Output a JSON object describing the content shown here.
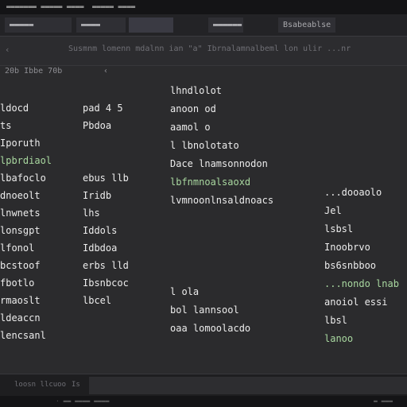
{
  "menubar": {
    "left": "▬▬▬▬▬▬▬ ▬▬▬▬▬ ▬▬▬▬",
    "right": "▬▬▬▬▬ ▬▬▬▬"
  },
  "tabs": [
    {
      "label": "▬▬▬▬▬",
      "state": "inactive"
    },
    {
      "label": "▬▬▬▬",
      "state": "inactive"
    },
    {
      "label": "",
      "state": "active"
    },
    {
      "label": "▬▬▬▬▬▬",
      "state": "inactive"
    },
    {
      "label": "Bsabeablse",
      "state": "inactive"
    }
  ],
  "toolbar": {
    "left_icon": "‹",
    "breadcrumb": "Susmnm lomenn mdalnn  ian   \"a\"  Ibrnalamnalbeml  lon  ulir  ...nr"
  },
  "gutter": {
    "left": "20b   Ibbe   70b",
    "mid": "‹"
  },
  "code_columns": {
    "col1": [
      {
        "text": "  ldocd",
        "class": "w"
      },
      {
        "text": "  ts",
        "class": "w"
      },
      {
        "text": "Iporuth",
        "class": "w"
      },
      {
        "text": "lpbrdiaol",
        "class": "g"
      },
      {
        "text": "  lbafoclo",
        "class": "w"
      },
      {
        "text": "  dnoeolt",
        "class": "w"
      },
      {
        "text": "lnwnets",
        "class": "w"
      },
      {
        "text": "lonsgpt",
        "class": "w"
      },
      {
        "text": "  lfonol",
        "class": "w"
      },
      {
        "text": "  bcstoof",
        "class": "w"
      },
      {
        "text": "  fbotlo",
        "class": "w"
      },
      {
        "text": "  rmaoslt",
        "class": "w"
      },
      {
        "text": "  ldeaccn",
        "class": "w"
      },
      {
        "text": "  lencsanl",
        "class": "w"
      }
    ],
    "col2": [
      {
        "text": "pad 4 5",
        "class": "w"
      },
      {
        "text": "Pbdoa",
        "class": "w"
      },
      {
        "text": "",
        "class": "w"
      },
      {
        "text": "",
        "class": "w"
      },
      {
        "text": "ebus llb",
        "class": "w"
      },
      {
        "text": "Iridb",
        "class": "w"
      },
      {
        "text": "lhs",
        "class": "w"
      },
      {
        "text": "Iddols",
        "class": "w"
      },
      {
        "text": "Idbdoa",
        "class": "w"
      },
      {
        "text": "erbs lld",
        "class": "w"
      },
      {
        "text": "Ibsnbcoc",
        "class": "w"
      },
      {
        "text": "lbcel",
        "class": "w"
      }
    ],
    "col3": [
      {
        "text": "lhndlolot",
        "class": "w"
      },
      {
        "text": "anoon od",
        "class": "w"
      },
      {
        "text": "aamol o",
        "class": "w"
      },
      {
        "text": "l lbnolotato",
        "class": "w"
      },
      {
        "text": "Dace lnamsonnodon",
        "class": "w"
      },
      {
        "text": "lbfnmnoalsaoxd",
        "class": "g"
      },
      {
        "text": "lvmnoonlnsaldnoacs",
        "class": "w"
      },
      {
        "text": "",
        "class": "w"
      },
      {
        "text": "",
        "class": "w"
      },
      {
        "text": "",
        "class": "w"
      },
      {
        "text": "",
        "class": "w"
      },
      {
        "text": "l ola",
        "class": "w"
      },
      {
        "text": "bol lannsool",
        "class": "w"
      },
      {
        "text": "oaa lomoolacdo",
        "class": "w"
      }
    ],
    "col4": [
      {
        "text": "...dooaolo",
        "class": "w"
      },
      {
        "text": "Jel",
        "class": "w"
      },
      {
        "text": "lsbsl",
        "class": "w"
      },
      {
        "text": "Inoobrvo",
        "class": "w"
      },
      {
        "text": "bs6snbboo",
        "class": "w"
      },
      {
        "text": "...nondo lnab",
        "class": "g"
      },
      {
        "text": "anoiol essi",
        "class": "w"
      },
      {
        "text": "lbsl",
        "class": "w"
      },
      {
        "text": "lanoo",
        "class": "g"
      }
    ]
  },
  "statusbar": {
    "left": "loosn llcuoo",
    "mid": "Is"
  },
  "bottom": {
    "left": "·   ▬▬  ▬▬▬▬ ▬▬▬▬",
    "right": "▬ ▬▬▬"
  },
  "colors": {
    "background": "#2b2b2d",
    "green_text": "#a9d8a0",
    "tab_active": "#3a3a43"
  }
}
